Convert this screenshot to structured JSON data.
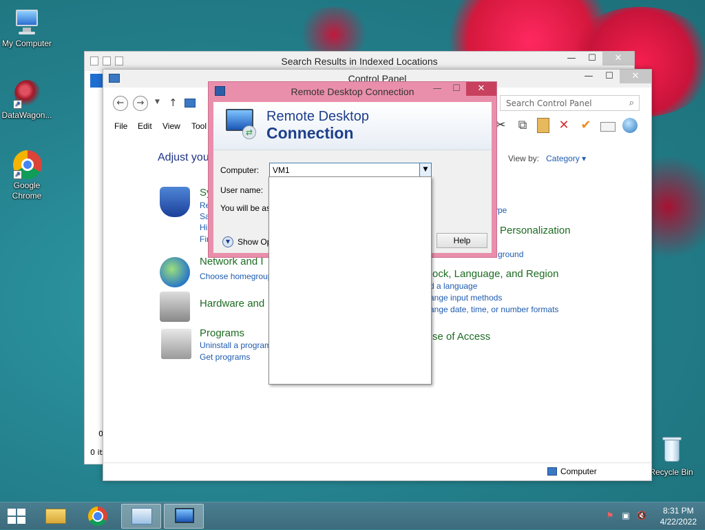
{
  "desktop": {
    "icons": [
      {
        "label": "My Computer"
      },
      {
        "label": "DataWagon..."
      },
      {
        "label": "Google Chrome"
      },
      {
        "label": "Recycle Bin"
      }
    ]
  },
  "search_window": {
    "title": "Search Results in Indexed Locations",
    "status_text": "0 it",
    "side_count": "0"
  },
  "control_panel": {
    "title": "Control Panel",
    "search_placeholder": "Search Control Panel",
    "menu": [
      "File",
      "Edit",
      "View",
      "Tool"
    ],
    "heading": "Adjust you",
    "view_by_label": "View by:",
    "view_by_value": "Category",
    "categories": [
      {
        "title": "Sy",
        "links": [
          "Re",
          "Sa",
          "Hi",
          "Fin"
        ]
      },
      {
        "title": "Network and I",
        "links": [
          "Choose homegroup"
        ]
      },
      {
        "title": "Hardware and",
        "links": []
      },
      {
        "title": "Programs",
        "links": [
          "Uninstall a program",
          "Get programs"
        ]
      }
    ],
    "right_categories": [
      {
        "title": "",
        "links": [
          "ype"
        ]
      },
      {
        "title": "Personalization",
        "links": [
          "ground"
        ]
      },
      {
        "title": "ock, Language, and Region",
        "links": [
          "d a language",
          "ange input methods",
          "ange date, time, or number formats"
        ]
      },
      {
        "title": "se of Access",
        "links": []
      }
    ],
    "status_computer": "Computer"
  },
  "rdc": {
    "title": "Remote Desktop Connection",
    "banner_line1": "Remote Desktop",
    "banner_line2": "Connection",
    "computer_label": "Computer:",
    "computer_value": "VM1",
    "username_label": "User name:",
    "note": "You will be ask",
    "show_options": "Show Opt",
    "help_label": "Help"
  },
  "taskbar": {
    "time": "8:31 PM",
    "date": "4/22/2022"
  }
}
